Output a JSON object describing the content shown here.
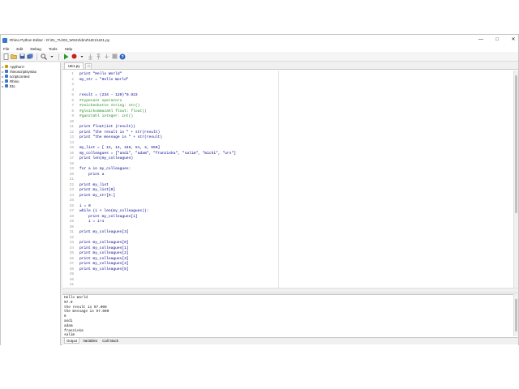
{
  "window": {
    "title": "Rhino Python Editor - D:\\01_TU\\03_WS24\\dmZ\\UE1\\UE1.py",
    "controls": [
      "—",
      "□",
      "✕"
    ]
  },
  "menu": [
    "File",
    "Edit",
    "Debug",
    "Tools",
    "Help"
  ],
  "sidebar": {
    "items": [
      {
        "label": "<python>",
        "color": "#c8a000"
      },
      {
        "label": "rhinoscriptsyntax",
        "color": "#3c78c8"
      },
      {
        "label": "scriptcontext",
        "color": "#3c78c8"
      },
      {
        "label": "Rhino",
        "color": "#3c78c8"
      },
      {
        "label": "Eto",
        "color": "#3c78c8"
      }
    ]
  },
  "editor": {
    "tab_label": "UE1.py",
    "line_numbers": [
      "1",
      "2",
      "3",
      "4",
      "5",
      "6",
      "7",
      "8",
      "9",
      "10",
      "11",
      "12",
      "13",
      "14",
      "15",
      "16",
      "17",
      "18",
      "19",
      "20",
      "21",
      "22",
      "23",
      "24",
      "25",
      "26",
      "27",
      "28",
      "29",
      "30",
      "31",
      "32",
      "33",
      "34",
      "35",
      "36",
      "37",
      "38",
      "39",
      "40",
      "41"
    ],
    "lines": [
      {
        "text": "print \"Hello World\"",
        "color": "#00008b"
      },
      {
        "text": "my_str = \"Hello World\"",
        "color": "#00008b"
      },
      {
        "text": "",
        "color": "#00008b"
      },
      {
        "text": "",
        "color": "#00008b"
      },
      {
        "text": "result = (234 - 120)*0.923",
        "color": "#00008b"
      },
      {
        "text": "#typecast operators",
        "color": "#228b22"
      },
      {
        "text": "#zeichenkette string: str()",
        "color": "#228b22"
      },
      {
        "text": "#gleitkommazahl float: float()",
        "color": "#228b22"
      },
      {
        "text": "#ganzzahl integer: int()",
        "color": "#228b22"
      },
      {
        "text": "",
        "color": "#00008b"
      },
      {
        "text": "print float(int (result))",
        "color": "#00008b"
      },
      {
        "text": "print \"the result is \" + str(result)",
        "color": "#00008b"
      },
      {
        "text": "print \"the message is \" + str(result)",
        "color": "#00008b"
      },
      {
        "text": "",
        "color": "#00008b"
      },
      {
        "text": "my_list = [ 12, 14, 345, 51, 3, 550]",
        "color": "#00008b"
      },
      {
        "text": "my_colleagues = [\"andi\", \"adam\", \"franziska\", \"salim\", \"michi\", \"urs\"]",
        "color": "#00008b"
      },
      {
        "text": "print len(my_colleagues)",
        "color": "#00008b"
      },
      {
        "text": "",
        "color": "#00008b"
      },
      {
        "text": "for a in my_colleagues:",
        "color": "#00008b"
      },
      {
        "text": "    print a",
        "color": "#00008b"
      },
      {
        "text": "",
        "color": "#00008b"
      },
      {
        "text": "print my_list",
        "color": "#00008b"
      },
      {
        "text": "print my_list[0]",
        "color": "#00008b"
      },
      {
        "text": "print my_str[5:]",
        "color": "#00008b"
      },
      {
        "text": "",
        "color": "#00008b"
      },
      {
        "text": "i = 0",
        "color": "#00008b"
      },
      {
        "text": "while (i < len(my_colleagues)):",
        "color": "#00008b"
      },
      {
        "text": "    print my_colleagues[i]",
        "color": "#00008b"
      },
      {
        "text": "    i = i+1",
        "color": "#00008b"
      },
      {
        "text": "",
        "color": "#00008b"
      },
      {
        "text": "print my_colleagues[3]",
        "color": "#00008b"
      },
      {
        "text": "",
        "color": "#00008b"
      },
      {
        "text": "print my_colleagues[0]",
        "color": "#00008b"
      },
      {
        "text": "print my_colleagues[1]",
        "color": "#00008b"
      },
      {
        "text": "print my_colleagues[2]",
        "color": "#00008b"
      },
      {
        "text": "print my_colleagues[3]",
        "color": "#00008b"
      },
      {
        "text": "print my_colleagues[4]",
        "color": "#00008b"
      },
      {
        "text": "print my_colleagues[5]",
        "color": "#00008b"
      },
      {
        "text": "",
        "color": "#00008b"
      },
      {
        "text": "",
        "color": "#00008b"
      },
      {
        "text": "",
        "color": "#00008b"
      }
    ]
  },
  "output": {
    "lines": [
      "Hello World",
      "97.0",
      "the result is 97.000",
      "the message is 97.000",
      "6",
      "andi",
      "adam",
      "franziska",
      "salim"
    ]
  },
  "bottom_tabs": [
    "Output",
    "Variables",
    "Call Stack"
  ]
}
